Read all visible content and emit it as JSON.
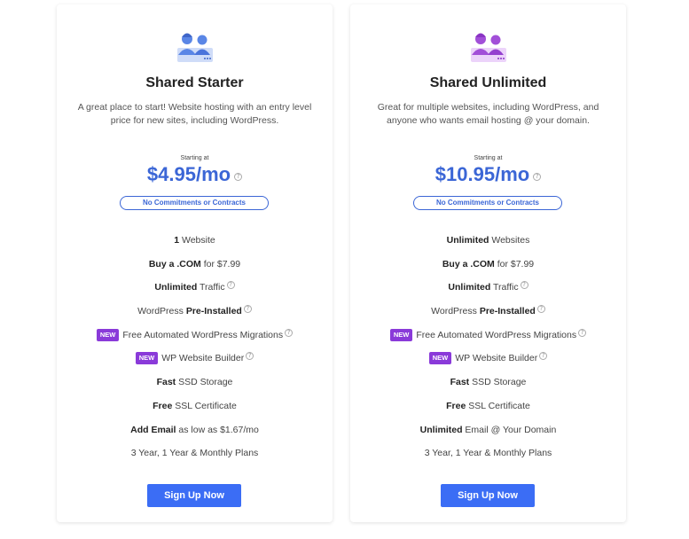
{
  "colors": {
    "accent": "#3b66d6",
    "button": "#3b6df5",
    "new_badge": "#8a3ad9",
    "icon_starter": "#5a86e6",
    "icon_unlimited": "#a24fd8"
  },
  "help_glyph": "?",
  "plans": [
    {
      "icon": "team-people-icon",
      "title": "Shared Starter",
      "description": "A great place to start! Website hosting with an entry level price for new sites, including WordPress.",
      "starting_label": "Starting at",
      "price": "$4.95/mo",
      "commitment": "No Commitments or Contracts",
      "features": {
        "f1": {
          "bold": "1",
          "text": " Website"
        },
        "f2": {
          "bold": "Buy a .COM",
          "text": " for $7.99"
        },
        "f3": {
          "bold": "Unlimited",
          "text": " Traffic"
        },
        "f4": {
          "text": "WordPress ",
          "bold": "Pre-Installed"
        },
        "f5": {
          "badge": "NEW",
          "text": "Free Automated WordPress Migrations"
        },
        "f6": {
          "badge": "NEW",
          "text": "WP Website Builder"
        },
        "f7": {
          "bold": "Fast",
          "text": " SSD Storage"
        },
        "f8": {
          "bold": "Free",
          "text": " SSL Certificate"
        },
        "f9": {
          "bold": "Add Email",
          "text": " as low as $1.67/mo"
        },
        "f10": {
          "text": "3 Year, 1 Year & Monthly Plans"
        }
      },
      "cta": "Sign Up Now"
    },
    {
      "icon": "team-people-icon",
      "title": "Shared Unlimited",
      "description": "Great for multiple websites, including WordPress, and anyone who wants email hosting @ your domain.",
      "starting_label": "Starting at",
      "price": "$10.95/mo",
      "commitment": "No Commitments or Contracts",
      "features": {
        "f1": {
          "bold": "Unlimited",
          "text": " Websites"
        },
        "f2": {
          "bold": "Buy a .COM",
          "text": " for $7.99"
        },
        "f3": {
          "bold": "Unlimited",
          "text": " Traffic"
        },
        "f4": {
          "text": "WordPress ",
          "bold": "Pre-Installed"
        },
        "f5": {
          "badge": "NEW",
          "text": "Free Automated WordPress Migrations"
        },
        "f6": {
          "badge": "NEW",
          "text": "WP Website Builder"
        },
        "f7": {
          "bold": "Fast",
          "text": " SSD Storage"
        },
        "f8": {
          "bold": "Free",
          "text": " SSL Certificate"
        },
        "f9": {
          "bold": "Unlimited",
          "text": " Email @ Your Domain"
        },
        "f10": {
          "text": "3 Year, 1 Year & Monthly Plans"
        }
      },
      "cta": "Sign Up Now"
    }
  ]
}
